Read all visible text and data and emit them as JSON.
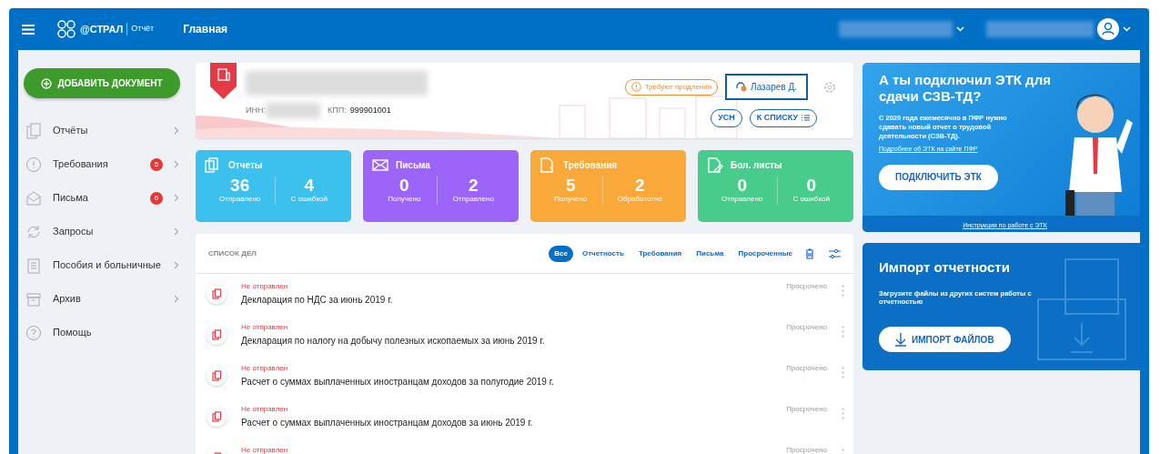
{
  "header": {
    "logo": "@СТРАЛ",
    "product": "Отчёт",
    "title": "Главная"
  },
  "sidebar": {
    "add_button": "ДОБАВИТЬ ДОКУМЕНТ",
    "items": [
      {
        "kind": "reports",
        "label": "Отчёты"
      },
      {
        "kind": "demands",
        "label": "Требования",
        "badge": "5"
      },
      {
        "kind": "letters",
        "label": "Письма",
        "badge": "6"
      },
      {
        "kind": "requests",
        "label": "Запросы"
      },
      {
        "kind": "benefits",
        "label": "Пособия и больничные"
      },
      {
        "kind": "archive",
        "label": "Архив"
      },
      {
        "kind": "help",
        "label": "Помощь"
      }
    ]
  },
  "company": {
    "inn_label": "ИНН:",
    "kpp_label": "КПП:",
    "kpp": "999901001",
    "warning": "Требуют продления",
    "user": "Лазарев Д.",
    "tags": [
      "УСН",
      "К СПИСКУ"
    ]
  },
  "stats": [
    {
      "kind": "reports",
      "title": "Отчеты",
      "color": "#3cc0ee",
      "metrics": [
        {
          "value": "36",
          "label": "Отправлено"
        },
        {
          "value": "4",
          "label": "С ошибкой"
        }
      ]
    },
    {
      "kind": "letters",
      "title": "Письма",
      "color": "#9d64f9",
      "metrics": [
        {
          "value": "0",
          "label": "Получено"
        },
        {
          "value": "2",
          "label": "Отправлено"
        }
      ]
    },
    {
      "kind": "demands",
      "title": "Требования",
      "color": "#f9a83a",
      "metrics": [
        {
          "value": "5",
          "label": "Получено"
        },
        {
          "value": "2",
          "label": "Обработотно"
        }
      ]
    },
    {
      "kind": "sick",
      "title": "Бол. листы",
      "color": "#48cc8b",
      "metrics": [
        {
          "value": "0",
          "label": "Отправлено"
        },
        {
          "value": "0",
          "label": "С ошибкой"
        }
      ]
    }
  ],
  "tasks": {
    "title": "СПИСОК ДЕЛ",
    "filters": [
      {
        "label": "Все",
        "selected": true
      },
      {
        "label": "Отчетность",
        "selected": false
      },
      {
        "label": "Требования",
        "selected": false
      },
      {
        "label": "Письма",
        "selected": false
      },
      {
        "label": "Просроченные",
        "selected": false
      }
    ],
    "rows": [
      {
        "status": "Не отправлен",
        "title": "Декларация по НДС за июнь 2019 г.",
        "due": "Просрочено"
      },
      {
        "status": "Не отправлен",
        "title": "Декларация по налогу на добычу полезных ископаемых за июнь 2019 г.",
        "due": "Просрочено"
      },
      {
        "status": "Не отправлен",
        "title": "Расчет о суммах выплаченных иностранцам доходов за полугодие 2019 г.",
        "due": "Просрочено"
      },
      {
        "status": "Не отправлен",
        "title": "Расчет о суммах выплаченных иностранцам доходов за июнь 2019 г.",
        "due": "Просрочено"
      },
      {
        "status": "Не отправлен",
        "due": "Просрочено"
      }
    ]
  },
  "promo": {
    "title": "А ты подключил ЭТК для сдачи СЗВ-ТД?",
    "text": "С 2020 года ежемесячно в ПФР нужно сдавать новый отчет о трудовой деятельности (СЗВ-ТД).",
    "link": "Подробнее об ЭТК на сайте ПФР",
    "button": "ПОДКЛЮЧИТЬ ЭТК",
    "footer_link": "Инструкция по работе с ЭТК"
  },
  "import": {
    "title": "Импорт отчетности",
    "text": "Загрузите файлы из других систем работы с отчетностью",
    "button": "ИМПОРТ ФАЙЛОВ"
  }
}
